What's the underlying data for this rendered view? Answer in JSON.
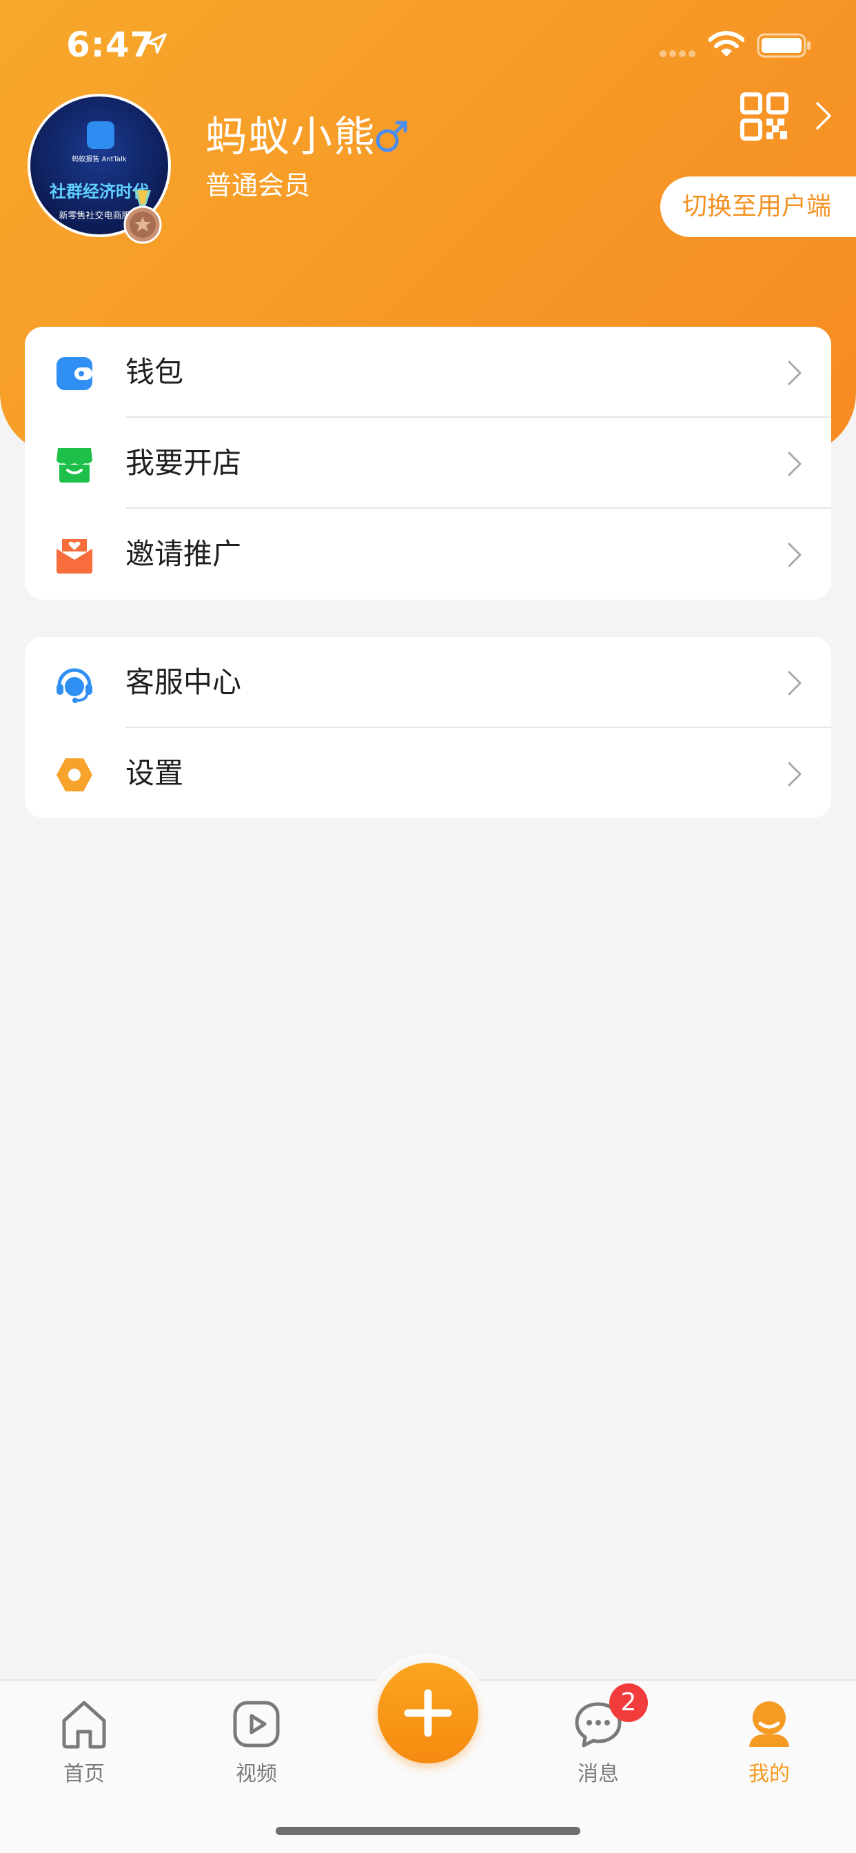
{
  "status_bar": {
    "time": "6:47"
  },
  "profile": {
    "name": "蚂蚁小熊",
    "level": "普通会员",
    "avatar": {
      "brand": "蚂蚁报售 AntTalk",
      "slogan": "社群经济时代",
      "subtitle": "新零售社交电商服务"
    },
    "switch_label": "切换至用户端"
  },
  "menu_group_1": [
    {
      "label": "钱包",
      "icon": "wallet-icon",
      "color": "#2f8ff3"
    },
    {
      "label": "我要开店",
      "icon": "store-icon",
      "color": "#1ec04a"
    },
    {
      "label": "邀请推广",
      "icon": "invite-icon",
      "color": "#f76d3b"
    }
  ],
  "menu_group_2": [
    {
      "label": "客服中心",
      "icon": "headset-icon",
      "color": "#2f8ff3"
    },
    {
      "label": "设置",
      "icon": "settings-icon",
      "color": "#f7a22a"
    }
  ],
  "tab_bar": {
    "home": "首页",
    "video": "视频",
    "messages": "消息",
    "messages_badge": "2",
    "me": "我的",
    "active": "me"
  },
  "colors": {
    "accent": "#f68b22",
    "header_start": "#f7a82c",
    "badge": "#f23b3b"
  }
}
